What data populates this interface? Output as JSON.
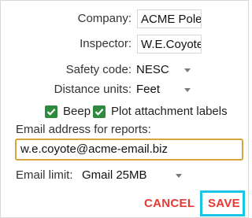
{
  "form": {
    "company_label": "Company:",
    "company_value": "ACME Pole",
    "inspector_label": "Inspector:",
    "inspector_value": "W.E.Coyote",
    "safety_code_label": "Safety code:",
    "safety_code_value": "NESC",
    "distance_units_label": "Distance units:",
    "distance_units_value": "Feet",
    "beep_label": "Beep",
    "beep_checked": true,
    "plot_labels_label": "Plot attachment labels",
    "plot_labels_checked": true,
    "email_address_label": "Email address for reports:",
    "email_address_value": "w.e.coyote@acme-email.biz",
    "email_limit_label": "Email limit:",
    "email_limit_value": "Gmail 25MB"
  },
  "actions": {
    "cancel_label": "CANCEL",
    "save_label": "SAVE"
  },
  "colors": {
    "accent_button": "#e53935",
    "checkbox": "#2e8b3d",
    "input_focus_border": "#d9a53c",
    "focus_ring": "#19c6e6"
  }
}
